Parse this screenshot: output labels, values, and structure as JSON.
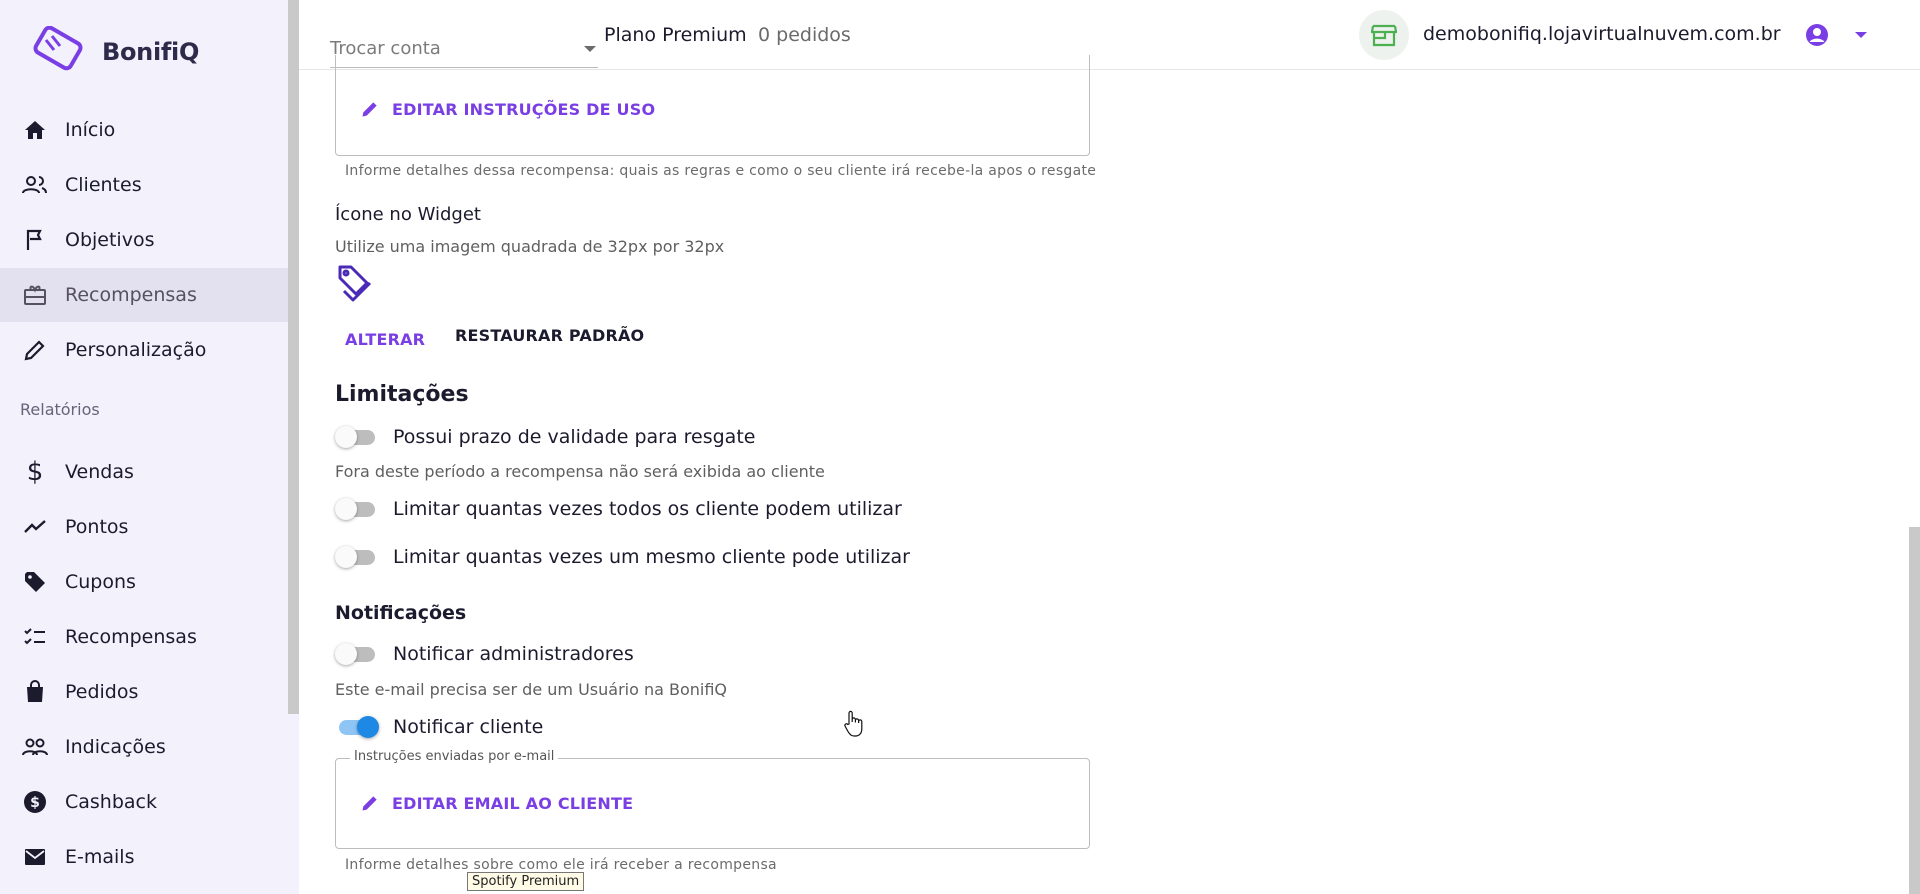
{
  "brand": {
    "name": "BonifiQ",
    "accent": "#7a3fe4"
  },
  "sidebar": {
    "items": [
      {
        "label": "Início",
        "icon": "home-icon"
      },
      {
        "label": "Clientes",
        "icon": "people-icon"
      },
      {
        "label": "Objetivos",
        "icon": "flag-icon"
      },
      {
        "label": "Recompensas",
        "icon": "gift-card-icon",
        "active": true
      },
      {
        "label": "Personalização",
        "icon": "pencil-icon"
      }
    ],
    "section_label": "Relatórios",
    "report_items": [
      {
        "label": "Vendas",
        "icon": "dollar-icon"
      },
      {
        "label": "Pontos",
        "icon": "trending-line-icon"
      },
      {
        "label": "Cupons",
        "icon": "tag-icon"
      },
      {
        "label": "Recompensas",
        "icon": "checklist-icon"
      },
      {
        "label": "Pedidos",
        "icon": "shopping-bag-icon"
      },
      {
        "label": "Indicações",
        "icon": "group-icon"
      },
      {
        "label": "Cashback",
        "icon": "dollar-circle-icon"
      },
      {
        "label": "E-mails",
        "icon": "mail-icon"
      }
    ]
  },
  "header": {
    "account_placeholder": "Trocar conta",
    "plan": "Plano Premium",
    "orders": "0 pedidos",
    "store_domain": "demobonifiq.lojavirtualnuvem.com.br"
  },
  "main": {
    "usage": {
      "edit_label": "EDITAR INSTRUÇÕES DE USO",
      "helper": "Informe detalhes dessa recompensa: quais as regras e como o seu cliente irá recebe-la apos o resgate"
    },
    "widget_icon": {
      "title": "Ícone no Widget",
      "hint": "Utilize uma imagem quadrada de 32px por 32px",
      "change_label": "ALTERAR",
      "restore_label": "RESTAURAR PADRÃO"
    },
    "limits": {
      "title": "Limitações",
      "validity_label": "Possui prazo de validade para resgate",
      "validity_on": false,
      "validity_hint": "Fora deste período a recompensa não será exibida ao cliente",
      "all_clients_label": "Limitar quantas vezes todos os cliente podem utilizar",
      "all_clients_on": false,
      "same_client_label": "Limitar quantas vezes um mesmo cliente pode utilizar",
      "same_client_on": false
    },
    "notifications": {
      "title": "Notificações",
      "admins_label": "Notificar administradores",
      "admins_on": false,
      "admins_hint": "Este e-mail precisa ser de um Usuário na BonifiQ",
      "client_label": "Notificar cliente",
      "client_on": true,
      "email_legend": "Instruções enviadas por e-mail",
      "email_edit_label": "EDITAR EMAIL AO CLIENTE",
      "email_helper": "Informe detalhes sobre como ele irá receber a recompensa"
    }
  },
  "tooltip": "Spotify Premium"
}
